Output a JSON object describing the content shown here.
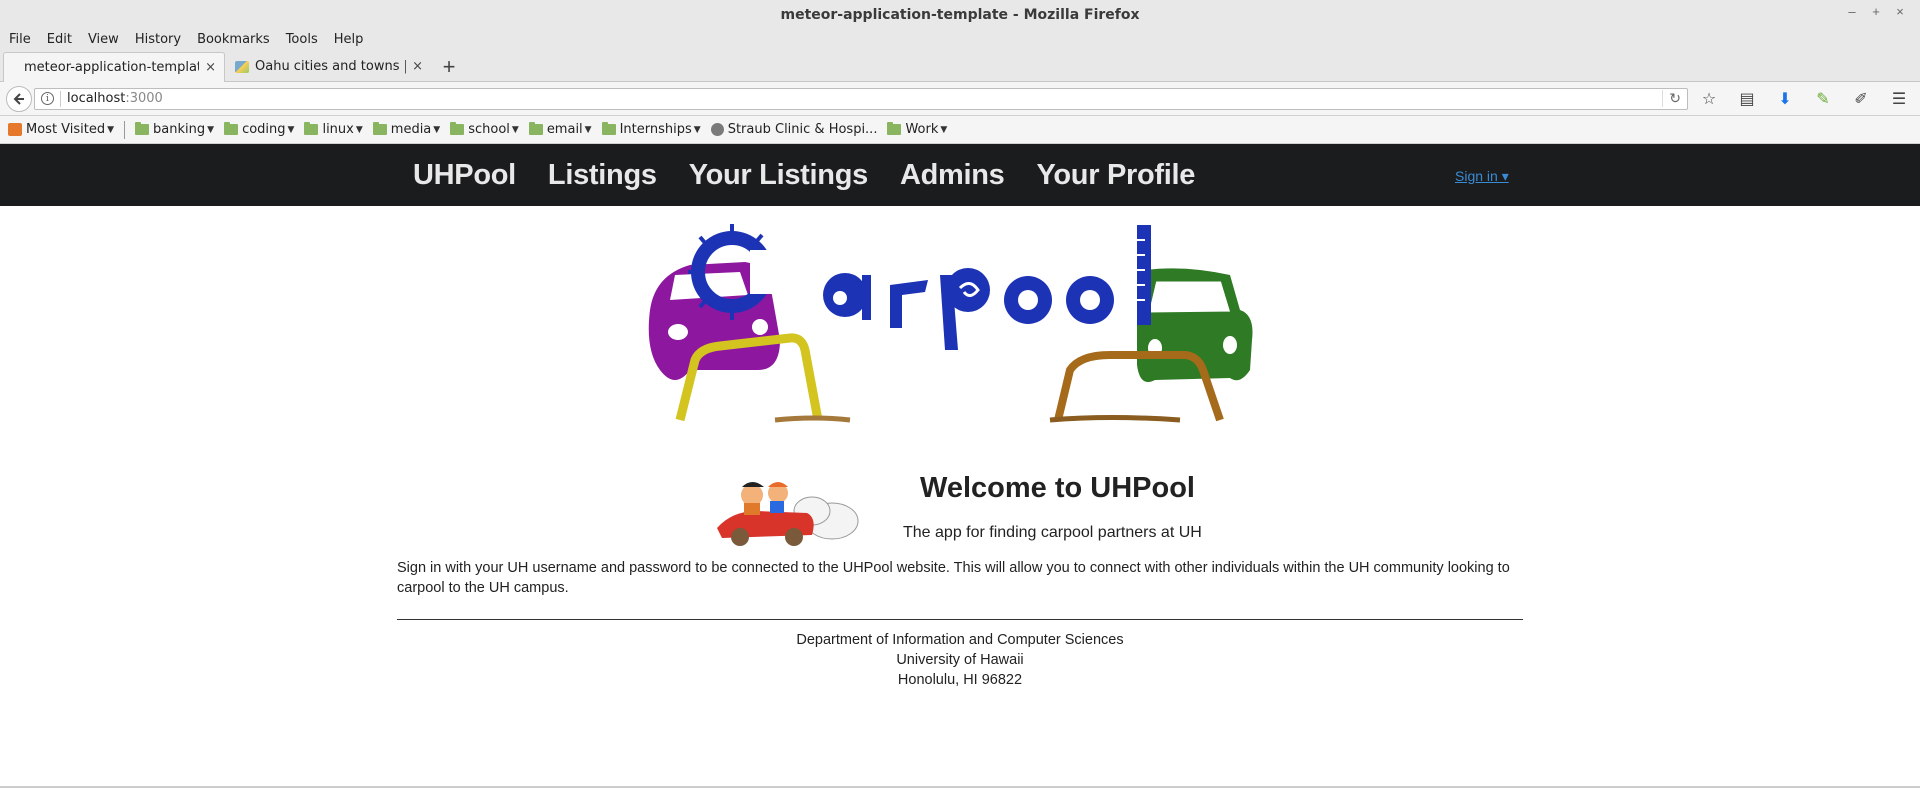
{
  "window": {
    "title": "meteor-application-template - Mozilla Firefox",
    "controls": [
      "–",
      "+",
      "×"
    ]
  },
  "menu": [
    "File",
    "Edit",
    "View",
    "History",
    "Bookmarks",
    "Tools",
    "Help"
  ],
  "tabs": [
    {
      "label": "meteor-application-template",
      "active": true,
      "close": "×"
    },
    {
      "label": "Oahu cities and towns | T...",
      "active": false,
      "close": "×"
    }
  ],
  "newtab": "+",
  "url": {
    "host": "localhost",
    "port": ":3000"
  },
  "bookmarks": [
    {
      "label": "Most Visited",
      "icon": "most-visited-icon",
      "dropdown": true
    },
    {
      "label": "banking",
      "icon": "folder-icon",
      "dropdown": true
    },
    {
      "label": "coding",
      "icon": "folder-icon",
      "dropdown": true
    },
    {
      "label": "linux",
      "icon": "folder-icon",
      "dropdown": true
    },
    {
      "label": "media",
      "icon": "folder-icon",
      "dropdown": true
    },
    {
      "label": "school",
      "icon": "folder-icon",
      "dropdown": true
    },
    {
      "label": "email",
      "icon": "folder-icon",
      "dropdown": true
    },
    {
      "label": "Internships",
      "icon": "folder-icon",
      "dropdown": true
    },
    {
      "label": "Straub Clinic & Hospi...",
      "icon": "globe-icon",
      "dropdown": false
    },
    {
      "label": "Work",
      "icon": "folder-icon",
      "dropdown": true
    }
  ],
  "site": {
    "nav": [
      "UHPool",
      "Listings",
      "Your Listings",
      "Admins",
      "Your Profile"
    ],
    "signin": "Sign in ▾",
    "logo_text": "Carpool",
    "welcome_title": "Welcome to UHPool",
    "welcome_sub": "The app for finding carpool partners at UH",
    "intro": "Sign in with your UH username and password to be connected to the UHPool website. This will allow you to connect with other individuals within the UH community looking to carpool to the UH campus.",
    "footer": [
      "Department of Information and Computer Sciences",
      "University of Hawaii",
      "Honolulu, HI 96822"
    ]
  },
  "colors": {
    "nav_bg": "#1b1c1d",
    "link": "#3a8bd6"
  }
}
